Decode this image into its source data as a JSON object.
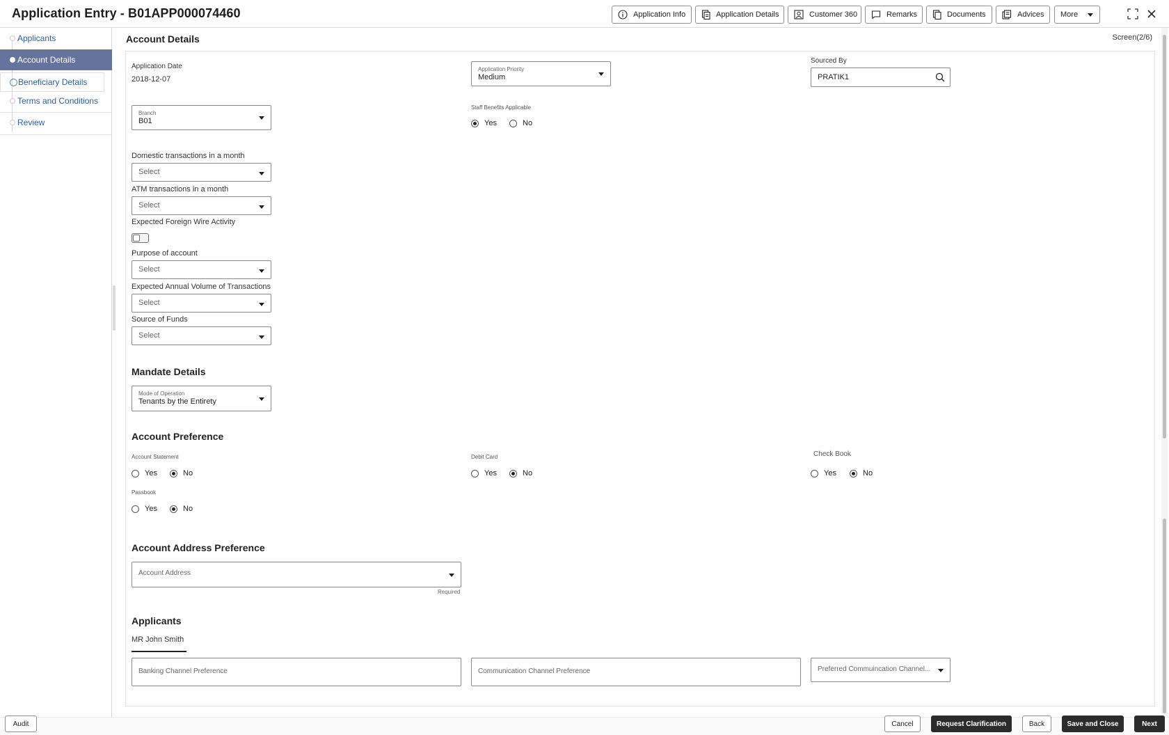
{
  "header": {
    "title": "Application Entry - B01APP000074460",
    "buttons": {
      "app_info": "Application Info",
      "app_details": "Application Details",
      "customer360": "Customer 360",
      "remarks": "Remarks",
      "documents": "Documents",
      "advices": "Advices",
      "more": "More"
    }
  },
  "sidebar": {
    "items": [
      {
        "label": "Applicants"
      },
      {
        "label": "Account Details"
      },
      {
        "label": "Beneficiary Details"
      },
      {
        "label": "Terms and Conditions"
      },
      {
        "label": "Review"
      }
    ]
  },
  "main": {
    "section_title": "Account Details",
    "screen_counter": "Screen(2/6)",
    "application_date": {
      "label": "Application Date",
      "value": "2018-12-07"
    },
    "application_priority": {
      "label": "Application Priority",
      "value": "Medium"
    },
    "sourced_by": {
      "label": "Sourced By",
      "value": "PRATIK1"
    },
    "branch": {
      "label": "Branch",
      "value": "B01"
    },
    "staff_benefits": {
      "label": "Staff Benefits Applicable",
      "yes": "Yes",
      "no": "No",
      "selected": "Yes"
    },
    "domestic_transactions": {
      "label": "Domestic transactions in a month",
      "placeholder": "Select"
    },
    "atm_transactions": {
      "label": "ATM transactions in a month",
      "placeholder": "Select"
    },
    "foreign_wire": {
      "label": "Expected Foreign Wire Activity",
      "on": false
    },
    "purpose": {
      "label": "Purpose of account",
      "placeholder": "Select"
    },
    "annual_volume": {
      "label": "Expected Annual Volume of Transactions",
      "placeholder": "Select"
    },
    "source_of_funds": {
      "label": "Source of Funds",
      "placeholder": "Select"
    },
    "mandate": {
      "heading": "Mandate Details",
      "mode_label": "Mode of Operation",
      "mode_value": "Tenants by the Entirety"
    },
    "account_preference": {
      "heading": "Account Preference",
      "account_statement": {
        "label": "Account Statement",
        "yes": "Yes",
        "no": "No",
        "selected": "No"
      },
      "debit_card": {
        "label": "Debit Card",
        "yes": "Yes",
        "no": "No",
        "selected": "No"
      },
      "check_book": {
        "label": "Check Book",
        "yes": "Yes",
        "no": "No",
        "selected": "No"
      },
      "passbook": {
        "label": "Passbook",
        "yes": "Yes",
        "no": "No",
        "selected": "No"
      }
    },
    "address_preference": {
      "heading": "Account Address Preference",
      "placeholder": "Account Address",
      "required": "Required"
    },
    "applicants": {
      "heading": "Applicants",
      "tab": "MR John Smith",
      "banking_channel": "Banking Channel Preference",
      "communication_channel": "Communication Channel Preference",
      "preferred_channel": "Preferred Commuincation Channel..."
    }
  },
  "footer": {
    "audit": "Audit",
    "cancel": "Cancel",
    "request_clarification": "Request Clarification",
    "back": "Back",
    "save_and_close": "Save and Close",
    "next": "Next"
  }
}
